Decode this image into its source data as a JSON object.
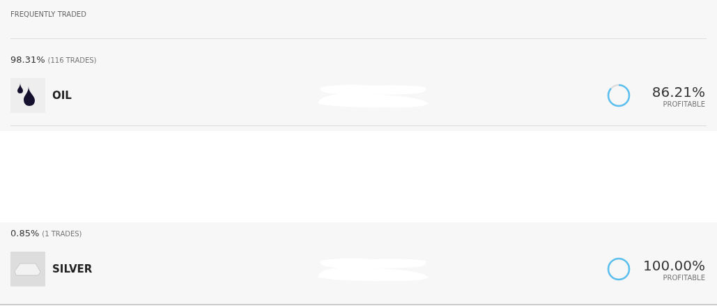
{
  "section_title": "FREQUENTLY TRADED",
  "instruments": [
    {
      "kind": "oil",
      "share": "98.31%",
      "trades": "(116 TRADES)",
      "name": "OIL",
      "profitable": "86.21%",
      "profitable_label": "PROFITABLE"
    },
    {
      "kind": "silver",
      "share": "0.85%",
      "trades": "(1 TRADES)",
      "name": "SILVER",
      "profitable": "100.00%",
      "profitable_label": "PROFITABLE"
    }
  ]
}
